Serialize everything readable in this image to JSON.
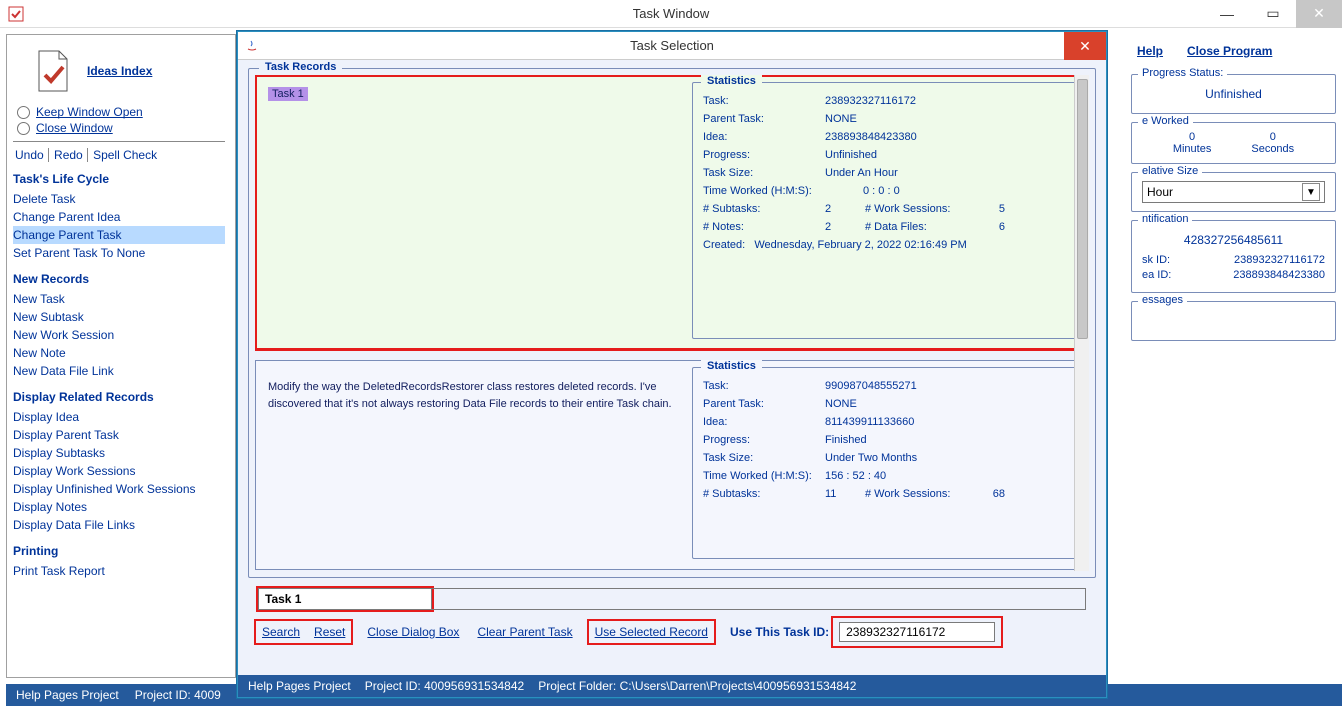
{
  "mainWindow": {
    "title": "Task Window",
    "statusbar": {
      "helpProject": "Help Pages Project",
      "projectIdLabel": "Project ID:",
      "projectId": "4009"
    }
  },
  "leftPanel": {
    "ideasIndex": "Ideas Index",
    "keepWindowOpen": "Keep Window Open",
    "closeWindow": "Close Window",
    "undo": "Undo",
    "redo": "Redo",
    "spellCheck": "Spell Check",
    "sections": {
      "lifeCycle": {
        "header": "Task's Life Cycle",
        "items": [
          "Delete Task",
          "Change Parent Idea",
          "Change Parent Task",
          "Set Parent Task To None"
        ]
      },
      "newRecords": {
        "header": "New Records",
        "items": [
          "New Task",
          "New Subtask",
          "New Work Session",
          "New Note",
          "New Data File Link"
        ]
      },
      "displayRelated": {
        "header": "Display Related Records",
        "items": [
          "Display Idea",
          "Display Parent Task",
          "Display Subtasks",
          "Display Work Sessions",
          "Display Unfinished Work Sessions",
          "Display Notes",
          "Display Data File Links"
        ]
      },
      "printing": {
        "header": "Printing",
        "items": [
          "Print Task Report"
        ]
      }
    }
  },
  "rightInfo": {
    "helpLink": "Help",
    "closeProgramLink": "Close Program",
    "progressStatusLabel": "Progress Status:",
    "progressStatusValue": "Unfinished",
    "workedLegend": "e Worked",
    "workedMinutesVal": "0",
    "workedSecondsVal": "0",
    "workedMinutesLabel": "Minutes",
    "workedSecondsLabel": "Seconds",
    "sizeLegend": "elative Size",
    "sizeValue": "Hour",
    "identLegend": "ntification",
    "identBigNum": "428327256485611",
    "taskIdLabel": "sk ID:",
    "taskIdVal": "238932327116172",
    "ideaIdLabel": "ea ID:",
    "ideaIdVal": "238893848423380",
    "messagesLegend": "essages"
  },
  "dialog": {
    "title": "Task Selection",
    "taskRecordsLegend": "Task Records",
    "records": [
      {
        "name": "Task 1",
        "selected": true,
        "desc": "",
        "stats": {
          "legend": "Statistics",
          "taskLabel": "Task:",
          "taskVal": "238932327116172",
          "parentLabel": "Parent Task:",
          "parentVal": "NONE",
          "ideaLabel": "Idea:",
          "ideaVal": "238893848423380",
          "progressLabel": "Progress:",
          "progressVal": "Unfinished",
          "sizeLabel": "Task Size:",
          "sizeVal": "Under An Hour",
          "timeWorkedLabel": "Time Worked (H:M:S):",
          "timeWorkedVal": "0 : 0 : 0",
          "subtasksLabel": "# Subtasks:",
          "subtasksVal": "2",
          "workSessionsLabel": "# Work Sessions:",
          "workSessionsVal": "5",
          "notesLabel": "# Notes:",
          "notesVal": "2",
          "dataFilesLabel": "# Data Files:",
          "dataFilesVal": "6",
          "createdLabel": "Created:",
          "createdVal": "Wednesday, February 2, 2022   02:16:49 PM"
        }
      },
      {
        "name": "",
        "selected": false,
        "desc": "Modify the way the DeletedRecordsRestorer class restores deleted records. I've discovered that it's not always restoring Data File records to their entire Task chain.",
        "stats": {
          "legend": "Statistics",
          "taskLabel": "Task:",
          "taskVal": "990987048555271",
          "parentLabel": "Parent Task:",
          "parentVal": "NONE",
          "ideaLabel": "Idea:",
          "ideaVal": "811439911133660",
          "progressLabel": "Progress:",
          "progressVal": "Finished",
          "sizeLabel": "Task Size:",
          "sizeVal": "Under Two Months",
          "timeWorkedLabel": "Time Worked (H:M:S):",
          "timeWorkedVal": "156 : 52 : 40",
          "subtasksLabel": "# Subtasks:",
          "subtasksVal": "11",
          "workSessionsLabel": "# Work Sessions:",
          "workSessionsVal": "68",
          "notesLabel": "",
          "notesVal": "",
          "dataFilesLabel": "",
          "dataFilesVal": "",
          "createdLabel": "",
          "createdVal": ""
        }
      }
    ],
    "searchInputValue": "Task 1",
    "buttons": {
      "search": "Search",
      "reset": "Reset",
      "closeDialog": "Close Dialog Box",
      "clearParent": "Clear Parent Task",
      "useSelected": "Use Selected Record",
      "useTaskIdLabel": "Use This Task ID:",
      "useTaskIdVal": "238932327116172"
    },
    "statusbar": {
      "helpProject": "Help Pages Project",
      "projectIdLabel": "Project ID:",
      "projectId": "400956931534842",
      "projectFolderLabel": "Project Folder:",
      "projectFolder": "C:\\Users\\Darren\\Projects\\400956931534842"
    }
  }
}
